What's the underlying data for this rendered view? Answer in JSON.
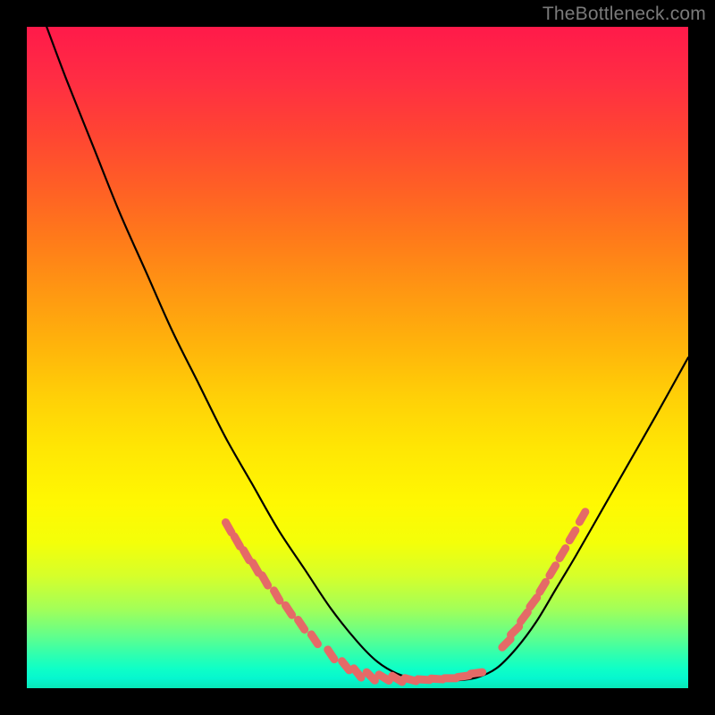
{
  "watermark": "TheBottleneck.com",
  "chart_data": {
    "type": "line",
    "title": "",
    "xlabel": "",
    "ylabel": "",
    "xlim": [
      0,
      100
    ],
    "ylim": [
      0,
      100
    ],
    "series": [
      {
        "name": "main-curve",
        "x": [
          3,
          6,
          10,
          14,
          18,
          22,
          26,
          30,
          34,
          38,
          42,
          46,
          50,
          53,
          56,
          59,
          62,
          65,
          68,
          71,
          74,
          77,
          80,
          83,
          87,
          91,
          95,
          100
        ],
        "y": [
          100,
          92,
          82,
          72,
          63,
          54,
          46,
          38,
          31,
          24,
          18,
          12,
          7,
          4,
          2.2,
          1.4,
          1.2,
          1.2,
          1.6,
          3,
          6,
          10,
          15,
          20,
          27,
          34,
          41,
          50
        ]
      },
      {
        "name": "left-dash-marks",
        "x": [
          30.5,
          31.8,
          33.2,
          34.6,
          36.0,
          37.8,
          39.6,
          41.5,
          43.5,
          46.0,
          48.2,
          50.0
        ],
        "y": [
          24.3,
          22.2,
          20.1,
          18.2,
          16.3,
          14.0,
          11.8,
          9.6,
          7.4,
          5.1,
          3.4,
          2.3
        ]
      },
      {
        "name": "bottom-dash-marks",
        "x": [
          52.0,
          54.0,
          56.0,
          58.0,
          60.0,
          62.0,
          64.0,
          66.0,
          68.0
        ],
        "y": [
          1.8,
          1.6,
          1.4,
          1.3,
          1.3,
          1.4,
          1.5,
          1.8,
          2.3
        ]
      },
      {
        "name": "right-dash-marks",
        "x": [
          72.5,
          73.8,
          75.2,
          76.6,
          78.0,
          79.5,
          81.0,
          82.5,
          84.0
        ],
        "y": [
          6.8,
          8.7,
          10.8,
          13.0,
          15.3,
          17.8,
          20.4,
          23.1,
          25.9
        ]
      }
    ],
    "colors": {
      "curve": "#000000",
      "marks": "#e56a67"
    }
  }
}
